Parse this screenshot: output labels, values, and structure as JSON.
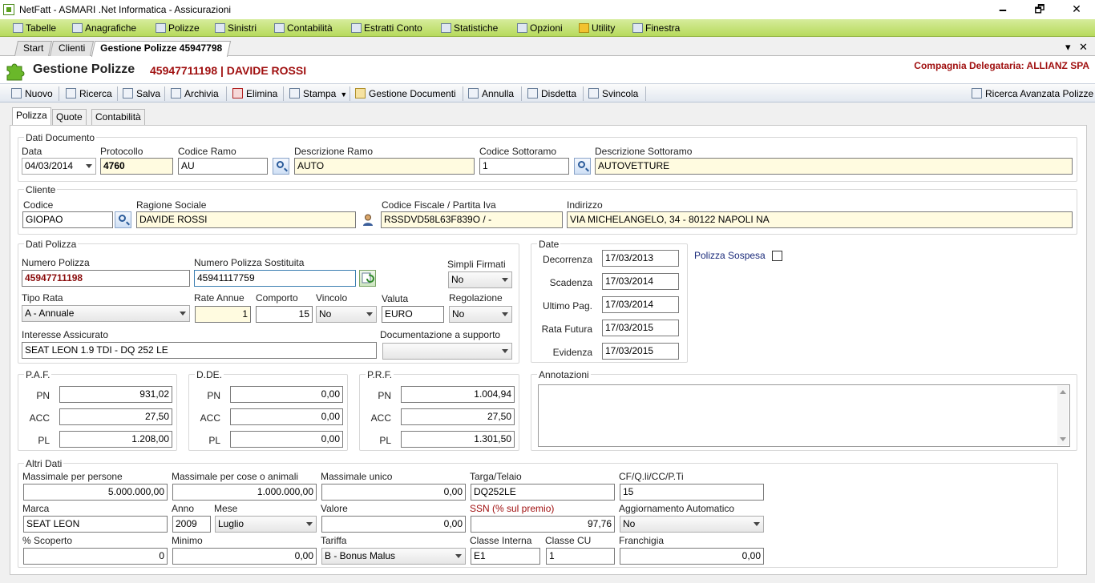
{
  "window": {
    "title": "NetFatt - ASMARI .Net Informatica - Assicurazioni",
    "minimize": "🗕",
    "maximize": "🗗",
    "close": "✕"
  },
  "menu": [
    {
      "label": "Tabelle",
      "icon": "table-icon"
    },
    {
      "label": "Anagrafiche",
      "icon": "people-icon"
    },
    {
      "label": "Polizze",
      "icon": "policy-icon"
    },
    {
      "label": "Sinistri",
      "icon": "claims-icon"
    },
    {
      "label": "Contabilità",
      "icon": "accounting-icon"
    },
    {
      "label": "Estratti Conto",
      "icon": "statement-icon"
    },
    {
      "label": "Statistiche",
      "icon": "chart-icon"
    },
    {
      "label": "Opzioni",
      "icon": "options-icon"
    },
    {
      "label": "Utility",
      "icon": "star-icon"
    },
    {
      "label": "Finestra",
      "icon": "window-icon"
    }
  ],
  "doc_tabs": [
    {
      "label": "Start"
    },
    {
      "label": "Clienti"
    },
    {
      "label": "Gestione Polizze 45947798"
    }
  ],
  "tab_controls": {
    "dropdown": "▾",
    "close": "✕"
  },
  "header": {
    "title": "Gestione Polizze",
    "policy": "45947711198 | DAVIDE ROSSI",
    "company": "Compagnia Delegataria: ALLIANZ SPA"
  },
  "toolbar": {
    "nuovo": "Nuovo",
    "ricerca": "Ricerca",
    "salva": "Salva",
    "archivia": "Archivia",
    "elimina": "Elimina",
    "stampa": "Stampa",
    "gestione_documenti": "Gestione Documenti",
    "annulla": "Annulla",
    "disdetta": "Disdetta",
    "svincola": "Svincola",
    "ricerca_avanzata": "Ricerca Avanzata Polizze"
  },
  "subtabs": {
    "polizza": "Polizza",
    "quote": "Quote",
    "contabilita": "Contabilità"
  },
  "dati_documento": {
    "legend": "Dati Documento",
    "data_label": "Data",
    "data_value": "04/03/2014",
    "protocollo_label": "Protocollo",
    "protocollo_value": "4760",
    "codice_ramo_label": "Codice Ramo",
    "codice_ramo_value": "AU",
    "descrizione_ramo_label": "Descrizione Ramo",
    "descrizione_ramo_value": "AUTO",
    "codice_sottoramo_label": "Codice Sottoramo",
    "codice_sottoramo_value": "1",
    "descrizione_sottoramo_label": "Descrizione Sottoramo",
    "descrizione_sottoramo_value": "AUTOVETTURE"
  },
  "cliente": {
    "legend": "Cliente",
    "codice_label": "Codice",
    "codice_value": "GIOPAO",
    "ragione_sociale_label": "Ragione Sociale",
    "ragione_sociale_value": "DAVIDE ROSSI",
    "cf_label": "Codice Fiscale / Partita Iva",
    "cf_value": "RSSDVD58L63F839O / -",
    "indirizzo_label": "Indirizzo",
    "indirizzo_value": "VIA MICHELANGELO, 34 - 80122 NAPOLI NA"
  },
  "dati_polizza": {
    "legend": "Dati Polizza",
    "numero_label": "Numero Polizza",
    "numero_value": "45947711198",
    "sostituita_label": "Numero Polizza Sostituita",
    "sostituita_value": "45941117759",
    "simpli_label": "Simpli Firmati",
    "simpli_value": "No",
    "tipo_rata_label": "Tipo Rata",
    "tipo_rata_value": "A - Annuale",
    "rate_annue_label": "Rate Annue",
    "rate_annue_value": "1",
    "comporto_label": "Comporto",
    "comporto_value": "15",
    "vincolo_label": "Vincolo",
    "vincolo_value": "No",
    "valuta_label": "Valuta",
    "valuta_value": "EURO",
    "regolazione_label": "Regolazione",
    "regolazione_value": "No",
    "interesse_label": "Interesse Assicurato",
    "interesse_value": "SEAT LEON 1.9 TDI - DQ 252 LE",
    "documentazione_label": "Documentazione a supporto",
    "documentazione_value": ""
  },
  "date": {
    "legend": "Date",
    "decorrenza_label": "Decorrenza",
    "decorrenza_value": "17/03/2013",
    "scadenza_label": "Scadenza",
    "scadenza_value": "17/03/2014",
    "ultimo_label": "Ultimo Pag.",
    "ultimo_value": "17/03/2014",
    "rata_futura_label": "Rata Futura",
    "rata_futura_value": "17/03/2015",
    "evidenza_label": "Evidenza",
    "evidenza_value": "17/03/2015"
  },
  "polizza_sospesa": {
    "label": "Polizza Sospesa",
    "checked": false
  },
  "paf": {
    "legend": "P.A.F.",
    "pn_label": "PN",
    "pn": "931,02",
    "acc_label": "ACC",
    "acc": "27,50",
    "pl_label": "PL",
    "pl": "1.208,00"
  },
  "dde": {
    "legend": "D.DE.",
    "pn_label": "PN",
    "pn": "0,00",
    "acc_label": "ACC",
    "acc": "0,00",
    "pl_label": "PL",
    "pl": "0,00"
  },
  "prf": {
    "legend": "P.R.F.",
    "pn_label": "PN",
    "pn": "1.004,94",
    "acc_label": "ACC",
    "acc": "27,50",
    "pl_label": "PL",
    "pl": "1.301,50"
  },
  "annotazioni": {
    "legend": "Annotazioni",
    "value": ""
  },
  "altri_dati": {
    "legend": "Altri Dati",
    "massimale_persone_label": "Massimale per persone",
    "massimale_persone_value": "5.000.000,00",
    "massimale_cose_label": "Massimale per cose o animali",
    "massimale_cose_value": "1.000.000,00",
    "massimale_unico_label": "Massimale unico",
    "massimale_unico_value": "0,00",
    "targa_label": "Targa/Telaio",
    "targa_value": "DQ252LE",
    "cf_qli_label": "CF/Q.li/CC/P.Ti",
    "cf_qli_value": "15",
    "marca_label": "Marca",
    "marca_value": "SEAT LEON",
    "anno_label": "Anno",
    "anno_value": "2009",
    "mese_label": "Mese",
    "mese_value": "Luglio",
    "valore_label": "Valore",
    "valore_value": "0,00",
    "ssn_label": "SSN (% sul premio)",
    "ssn_value": "97,76",
    "aggiornamento_label": "Aggiornamento Automatico",
    "aggiornamento_value": "No",
    "scoperto_label": "% Scoperto",
    "scoperto_value": "0",
    "minimo_label": "Minimo",
    "minimo_value": "0,00",
    "tariffa_label": "Tariffa",
    "tariffa_value": "B - Bonus Malus",
    "classe_interna_label": "Classe Interna",
    "classe_interna_value": "E1",
    "classe_cu_label": "Classe CU",
    "classe_cu_value": "1",
    "franchigia_label": "Franchigia",
    "franchigia_value": "0,00"
  },
  "colors": {
    "menu_green": "#b7da5c",
    "accent_red": "#a01010",
    "toolbar_blue": "#e2e8f0"
  }
}
